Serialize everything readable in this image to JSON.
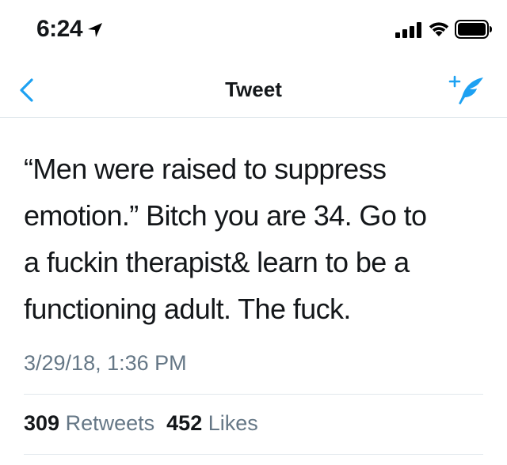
{
  "status_bar": {
    "time": "6:24",
    "icons": [
      "location-arrow-icon",
      "cellular-signal-icon",
      "wifi-icon",
      "battery-icon"
    ]
  },
  "nav": {
    "title": "Tweet",
    "back_icon": "chevron-left-icon",
    "compose_icon": "compose-tweet-icon",
    "accent_color": "#1da1f2"
  },
  "tweet": {
    "text": "“Men were raised to suppress\nemotion.” Bitch you are 34. Go to\na fuckin therapist& learn to be a\nfunctioning adult. The fuck.",
    "timestamp": "3/29/18, 1:36 PM"
  },
  "stats": {
    "retweets_count": "309",
    "retweets_label": "Retweets",
    "likes_count": "452",
    "likes_label": "Likes"
  },
  "colors": {
    "text_primary": "#14171a",
    "text_secondary": "#657786",
    "divider": "#e1e8ed"
  }
}
